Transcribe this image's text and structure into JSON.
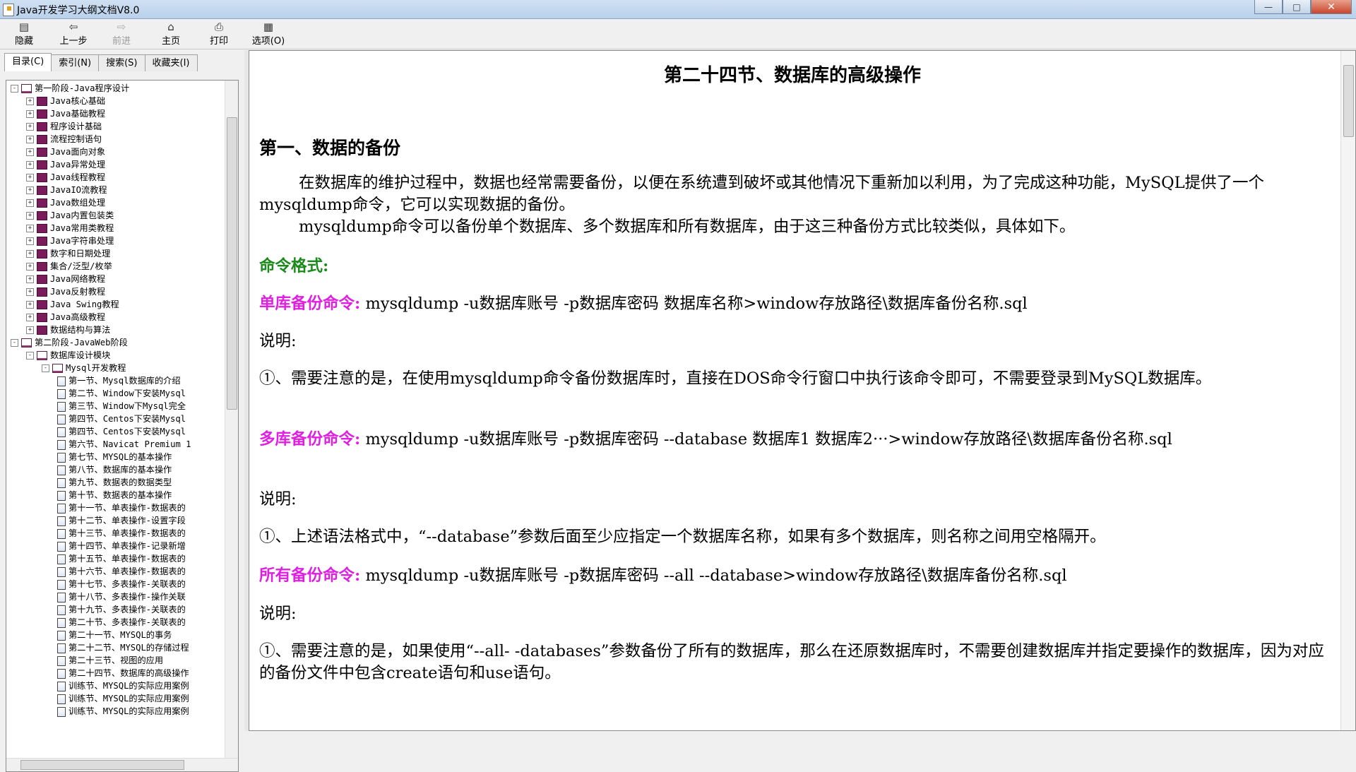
{
  "window": {
    "title": "Java开发学习大纲文档V8.0",
    "buttons": {
      "minimize": "—",
      "maximize": "□",
      "close": "✕"
    }
  },
  "toolbar": {
    "hide": "隐藏",
    "back": "上一步",
    "forward": "前进",
    "home": "主页",
    "print": "打印",
    "options": "选项(O)"
  },
  "tabs": [
    "目录(C)",
    "索引(N)",
    "搜索(S)",
    "收藏夹(I)"
  ],
  "tree": [
    {
      "level": 0,
      "icon": "open",
      "exp": "-",
      "label": "第一阶段-Java程序设计"
    },
    {
      "level": 1,
      "icon": "book",
      "exp": "+",
      "label": "Java核心基础"
    },
    {
      "level": 1,
      "icon": "book",
      "exp": "+",
      "label": "Java基础教程"
    },
    {
      "level": 1,
      "icon": "book",
      "exp": "+",
      "label": "程序设计基础"
    },
    {
      "level": 1,
      "icon": "book",
      "exp": "+",
      "label": "流程控制语句"
    },
    {
      "level": 1,
      "icon": "book",
      "exp": "+",
      "label": "Java面向对象"
    },
    {
      "level": 1,
      "icon": "book",
      "exp": "+",
      "label": "Java异常处理"
    },
    {
      "level": 1,
      "icon": "book",
      "exp": "+",
      "label": "Java线程教程"
    },
    {
      "level": 1,
      "icon": "book",
      "exp": "+",
      "label": "JavaIO流教程"
    },
    {
      "level": 1,
      "icon": "book",
      "exp": "+",
      "label": "Java数组处理"
    },
    {
      "level": 1,
      "icon": "book",
      "exp": "+",
      "label": "Java内置包装类"
    },
    {
      "level": 1,
      "icon": "book",
      "exp": "+",
      "label": "Java常用类教程"
    },
    {
      "level": 1,
      "icon": "book",
      "exp": "+",
      "label": "Java字符串处理"
    },
    {
      "level": 1,
      "icon": "book",
      "exp": "+",
      "label": "数字和日期处理"
    },
    {
      "level": 1,
      "icon": "book",
      "exp": "+",
      "label": "集合/泛型/枚举"
    },
    {
      "level": 1,
      "icon": "book",
      "exp": "+",
      "label": "Java网络教程"
    },
    {
      "level": 1,
      "icon": "book",
      "exp": "+",
      "label": "Java反射教程"
    },
    {
      "level": 1,
      "icon": "book",
      "exp": "+",
      "label": "Java Swing教程"
    },
    {
      "level": 1,
      "icon": "book",
      "exp": "+",
      "label": "Java高级教程"
    },
    {
      "level": 1,
      "icon": "book",
      "exp": "+",
      "label": "数据结构与算法"
    },
    {
      "level": 0,
      "icon": "open",
      "exp": "-",
      "label": "第二阶段-JavaWeb阶段"
    },
    {
      "level": 1,
      "icon": "open",
      "exp": "-",
      "label": "数据库设计模块"
    },
    {
      "level": 2,
      "icon": "open",
      "exp": "-",
      "label": "Mysql开发教程"
    },
    {
      "level": 3,
      "icon": "page",
      "exp": "",
      "label": "第一节、Mysql数据库的介绍"
    },
    {
      "level": 3,
      "icon": "page",
      "exp": "",
      "label": "第二节、Window下安装Mysql"
    },
    {
      "level": 3,
      "icon": "page",
      "exp": "",
      "label": "第三节、Window下Mysql完全"
    },
    {
      "level": 3,
      "icon": "page",
      "exp": "",
      "label": "第四节、Centos下安装Mysql"
    },
    {
      "level": 3,
      "icon": "page",
      "exp": "",
      "label": "第四节、Centos下安装Mysql"
    },
    {
      "level": 3,
      "icon": "page",
      "exp": "",
      "label": "第六节、Navicat Premium 1"
    },
    {
      "level": 3,
      "icon": "page",
      "exp": "",
      "label": "第七节、MYSQL的基本操作"
    },
    {
      "level": 3,
      "icon": "page",
      "exp": "",
      "label": "第八节、数据库的基本操作"
    },
    {
      "level": 3,
      "icon": "page",
      "exp": "",
      "label": "第九节、数据表的数据类型"
    },
    {
      "level": 3,
      "icon": "page",
      "exp": "",
      "label": "第十节、数据表的基本操作"
    },
    {
      "level": 3,
      "icon": "page",
      "exp": "",
      "label": "第十一节、单表操作-数据表的"
    },
    {
      "level": 3,
      "icon": "page",
      "exp": "",
      "label": "第十二节、单表操作-设置字段"
    },
    {
      "level": 3,
      "icon": "page",
      "exp": "",
      "label": "第十三节、单表操作-数据表的"
    },
    {
      "level": 3,
      "icon": "page",
      "exp": "",
      "label": "第十四节、单表操作-记录新增"
    },
    {
      "level": 3,
      "icon": "page",
      "exp": "",
      "label": "第十五节、单表操作-数据表的"
    },
    {
      "level": 3,
      "icon": "page",
      "exp": "",
      "label": "第十六节、单表操作-数据表的"
    },
    {
      "level": 3,
      "icon": "page",
      "exp": "",
      "label": "第十七节、多表操作-关联表的"
    },
    {
      "level": 3,
      "icon": "page",
      "exp": "",
      "label": "第十八节、多表操作-操作关联"
    },
    {
      "level": 3,
      "icon": "page",
      "exp": "",
      "label": "第十九节、多表操作-关联表的"
    },
    {
      "level": 3,
      "icon": "page",
      "exp": "",
      "label": "第二十节、多表操作-关联表的"
    },
    {
      "level": 3,
      "icon": "page",
      "exp": "",
      "label": "第二十一节、MYSQL的事务"
    },
    {
      "level": 3,
      "icon": "page",
      "exp": "",
      "label": "第二十二节、MYSQL的存储过程"
    },
    {
      "level": 3,
      "icon": "page",
      "exp": "",
      "label": "第二十三节、视图的应用"
    },
    {
      "level": 3,
      "icon": "page",
      "exp": "",
      "label": "第二十四节、数据库的高级操作"
    },
    {
      "level": 3,
      "icon": "page",
      "exp": "",
      "label": "训练节、MYSQL的实际应用案例"
    },
    {
      "level": 3,
      "icon": "page",
      "exp": "",
      "label": "训练节、MYSQL的实际应用案例"
    },
    {
      "level": 3,
      "icon": "page",
      "exp": "",
      "label": "训练节、MYSQL的实际应用案例"
    }
  ],
  "doc": {
    "title": "第二十四节、数据库的高级操作",
    "section1": "第一、数据的备份",
    "intro1": "在数据库的维护过程中，数据也经常需要备份，以便在系统遭到破坏或其他情况下重新加以利用，为了完成这种功能，MySQL提供了一个mysqldump命令，它可以实现数据的备份。",
    "intro2": "mysqldump命令可以备份单个数据库、多个数据库和所有数据库，由于这三种备份方式比较类似，具体如下。",
    "cmd_format": "命令格式:",
    "single_label": "单库备份命令:",
    "single_cmd": " mysqldump -u数据库账号 -p数据库密码 数据库名称>window存放路径\\数据库备份名称.sql",
    "note1": "说明:",
    "note1_text": "①、需要注意的是，在使用mysqldump命令备份数据库时，直接在DOS命令行窗口中执行该命令即可，不需要登录到MySQL数据库。",
    "multi_label": "多库备份命令:",
    "multi_cmd": " mysqldump -u数据库账号 -p数据库密码 --database 数据库1 数据库2···>window存放路径\\数据库备份名称.sql",
    "note2": "说明:",
    "note2_text": "①、上述语法格式中，“--database”参数后面至少应指定一个数据库名称，如果有多个数据库，则名称之间用空格隔开。",
    "all_label": "所有备份命令:",
    "all_cmd": " mysqldump -u数据库账号 -p数据库密码 --all --database>window存放路径\\数据库备份名称.sql",
    "note3": "说明:",
    "note3_text": "①、需要注意的是，如果使用“--all- -databases”参数备份了所有的数据库，那么在还原数据库时，不需要创建数据库并指定要操作的数据库，因为对应的备份文件中包含create语句和use语句。"
  }
}
